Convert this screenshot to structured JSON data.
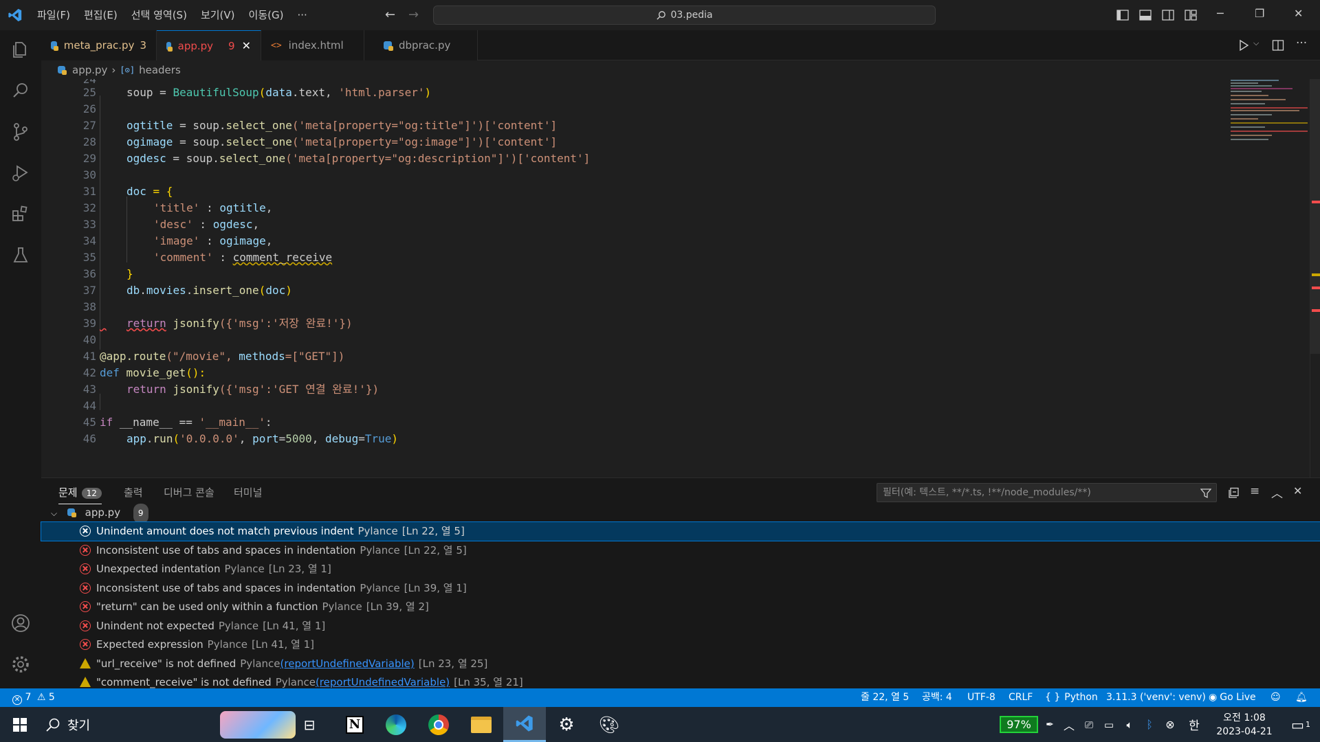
{
  "titlebar": {
    "menus": [
      "파일(F)",
      "편집(E)",
      "선택 영역(S)",
      "보기(V)",
      "이동(G)",
      "···"
    ],
    "search_text": "03.pedia"
  },
  "tabs": [
    {
      "label": "meta_prac.py",
      "count": "3",
      "icon": "python-icon"
    },
    {
      "label": "app.py",
      "count": "9",
      "icon": "python-icon",
      "active": true
    },
    {
      "label": "index.html",
      "count": "",
      "icon": "html-icon"
    },
    {
      "label": "dbprac.py",
      "count": "",
      "icon": "python-icon"
    }
  ],
  "breadcrumb": {
    "file": "app.py",
    "symbol": "headers"
  },
  "code_lines": [
    "24",
    "25",
    "26",
    "27",
    "28",
    "29",
    "30",
    "31",
    "32",
    "33",
    "34",
    "35",
    "36",
    "37",
    "38",
    "39",
    "40",
    "41",
    "42",
    "43",
    "44",
    "45",
    "46"
  ],
  "code": {
    "l25a": "soup = ",
    "l25b": "BeautifulSoup",
    "l25c": "(",
    "l25d": "data",
    "l25e": ".text, ",
    "l25f": "'html.parser'",
    "l25g": ")",
    "l27a": "ogtitle",
    "l27b": " = soup.",
    "l27c": "select_one",
    "l27d": "('meta[property=\"og:title\"]')['content']",
    "l28a": "ogimage",
    "l28b": " = soup.",
    "l28c": "select_one",
    "l28d": "('meta[property=\"og:image\"]')['content']",
    "l29a": "ogdesc",
    "l29b": " = soup.",
    "l29c": "select_one",
    "l29d": "('meta[property=\"og:description\"]')['content']",
    "l31a": "doc",
    "l31b": " = {",
    "l32a": "'title'",
    "l32b": " : ",
    "l32c": "ogtitle",
    "l32d": ",",
    "l33a": "'desc'",
    "l33b": " : ",
    "l33c": "ogdesc",
    "l33d": ",",
    "l34a": "'image'",
    "l34b": " : ",
    "l34c": "ogimage",
    "l34d": ",",
    "l35a": "'comment'",
    "l35b": " : ",
    "l35c": "comment_receive",
    "l36a": "}",
    "l37a": "db",
    "l37b": ".",
    "l37c": "movies",
    "l37d": ".",
    "l37e": "insert_one",
    "l37f": "(",
    "l37g": "doc",
    "l37h": ")",
    "l39a": "return",
    "l39b": " ",
    "l39c": "jsonify",
    "l39d": "({'msg':'저장 완료!'})",
    "l41a": "@app.route",
    "l41b": "(\"/movie\", ",
    "l41c": "methods",
    "l41d": "=[\"GET\"])",
    "l42a": "def",
    "l42b": " ",
    "l42c": "movie_get",
    "l42d": "():",
    "l43a": "return",
    "l43b": " ",
    "l43c": "jsonify",
    "l43d": "({'msg':'GET 연결 완료!'})",
    "l45a": "if",
    "l45b": " __name__ == ",
    "l45c": "'__main__'",
    "l45d": ":",
    "l46a": "app",
    "l46b": ".",
    "l46c": "run",
    "l46d": "(",
    "l46e": "'0.0.0.0'",
    "l46f": ", ",
    "l46g": "port",
    "l46h": "=",
    "l46i": "5000",
    "l46j": ", ",
    "l46k": "debug",
    "l46l": "=",
    "l46m": "True",
    "l46n": ")"
  },
  "panel": {
    "tabs": [
      "문제",
      "출력",
      "디버그 콘솔",
      "터미널"
    ],
    "problem_count": "12",
    "filter_placeholder": "필터(예: 텍스트, **/*.ts, !**/node_modules/**)",
    "group_file": "app.py",
    "group_count": "9",
    "problems": [
      {
        "type": "error",
        "msg": "Unindent amount does not match previous indent",
        "src": "Pylance",
        "link": "",
        "loc": "[Ln 22, 열 5]"
      },
      {
        "type": "error",
        "msg": "Inconsistent use of tabs and spaces in indentation",
        "src": "Pylance",
        "link": "",
        "loc": "[Ln 22, 열 5]"
      },
      {
        "type": "error",
        "msg": "Unexpected indentation",
        "src": "Pylance",
        "link": "",
        "loc": "[Ln 23, 열 1]"
      },
      {
        "type": "error",
        "msg": "Inconsistent use of tabs and spaces in indentation",
        "src": "Pylance",
        "link": "",
        "loc": "[Ln 39, 열 1]"
      },
      {
        "type": "error",
        "msg": "\"return\" can be used only within a function",
        "src": "Pylance",
        "link": "",
        "loc": "[Ln 39, 열 2]"
      },
      {
        "type": "error",
        "msg": "Unindent not expected",
        "src": "Pylance",
        "link": "",
        "loc": "[Ln 41, 열 1]"
      },
      {
        "type": "error",
        "msg": "Expected expression",
        "src": "Pylance",
        "link": "",
        "loc": "[Ln 41, 열 1]"
      },
      {
        "type": "warning",
        "msg": "\"url_receive\" is not defined",
        "src": "Pylance",
        "link": "(reportUndefinedVariable)",
        "loc": "[Ln 23, 열 25]"
      },
      {
        "type": "warning",
        "msg": "\"comment_receive\" is not defined",
        "src": "Pylance",
        "link": "(reportUndefinedVariable)",
        "loc": "[Ln 35, 열 21]"
      }
    ]
  },
  "statusbar": {
    "errors": "7",
    "warnings": "5",
    "position": "줄 22, 열 5",
    "spaces": "공백: 4",
    "encoding": "UTF-8",
    "eol": "CRLF",
    "language": "Python",
    "interpreter": "3.11.3 ('venv': venv)",
    "golive": "Go Live"
  },
  "taskbar": {
    "search_label": "찾기",
    "battery": "97%",
    "ime": "한",
    "time": "오전 1:08",
    "date": "2023-04-21",
    "notification_count": "1"
  },
  "colors": {
    "accent": "#0078d4",
    "error": "#f14c4c",
    "warning": "#cca700",
    "tab_modified": "#e2c08d"
  }
}
